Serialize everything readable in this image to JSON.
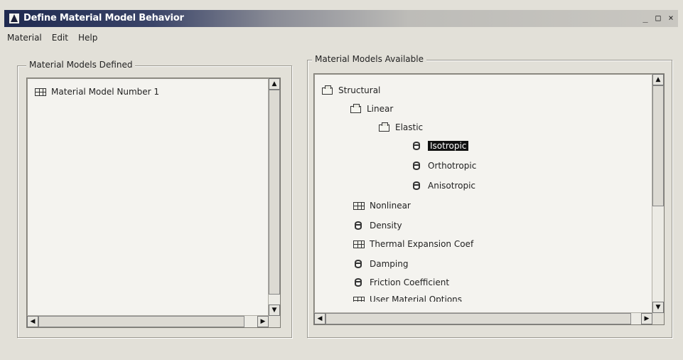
{
  "window": {
    "title": "Define Material Model Behavior",
    "controls": {
      "minimize": "_",
      "maximize": "□",
      "close": "×"
    }
  },
  "menu": {
    "items": [
      "Material",
      "Edit",
      "Help"
    ]
  },
  "defined_panel": {
    "label": "Material Models Defined",
    "items": [
      {
        "label": "Material Model Number 1",
        "icon": "table-icon"
      }
    ]
  },
  "available_panel": {
    "label": "Material Models Available",
    "tree": [
      {
        "label": "Structural",
        "icon": "folder-icon",
        "level": 0
      },
      {
        "label": "Linear",
        "icon": "folder-icon",
        "level": 1
      },
      {
        "label": "Elastic",
        "icon": "folder-icon",
        "level": 2
      },
      {
        "label": "Isotropic",
        "icon": "material-icon",
        "level": 3,
        "selected": true
      },
      {
        "label": "Orthotropic",
        "icon": "material-icon",
        "level": 3
      },
      {
        "label": "Anisotropic",
        "icon": "material-icon",
        "level": 3
      },
      {
        "label": "Nonlinear",
        "icon": "table-icon",
        "level": 1
      },
      {
        "label": "Density",
        "icon": "material-icon",
        "level": 1
      },
      {
        "label": "Thermal Expansion Coef",
        "icon": "table-icon",
        "level": 1
      },
      {
        "label": "Damping",
        "icon": "material-icon",
        "level": 1
      },
      {
        "label": "Friction Coefficient",
        "icon": "material-icon",
        "level": 1
      },
      {
        "label": "User Material Options",
        "icon": "table-icon",
        "level": 1
      }
    ]
  },
  "scroll_glyphs": {
    "up": "▲",
    "down": "▼",
    "left": "◀",
    "right": "▶"
  },
  "colors": {
    "titlebar_start": "#1f2a50",
    "window_bg": "#e2e0d8",
    "selection": "#111111"
  }
}
